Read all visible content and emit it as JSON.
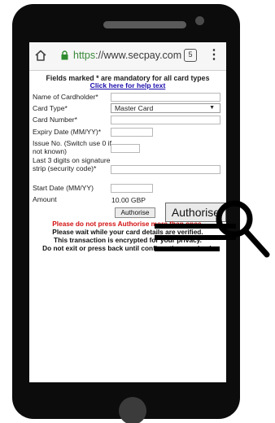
{
  "browser": {
    "url_protocol": "https",
    "url_rest": "://www.secpay.com",
    "tab_count": "5"
  },
  "form": {
    "intro": "Fields marked * are mandatory for all card types",
    "help_link": "Click here for help text",
    "labels": {
      "name": "Name of Cardholder*",
      "card_type": "Card Type*",
      "card_number": "Card Number*",
      "expiry": "Expiry Date (MM/YY)*",
      "issue": "Issue No. (Switch use 0 if not known)",
      "security": "Last 3 digits on signature strip (security code)*",
      "start": "Start Date (MM/YY)",
      "amount": "Amount"
    },
    "card_type_value": "Master Card",
    "amount_value": "10.00 GBP",
    "authorise_small": "Authorise",
    "authorise_big": "Authorise"
  },
  "messages": {
    "warning_red": "Please do not press Authorise more than once.",
    "wait": "Please wait while your card details are verified.",
    "encrypted": "This transaction is encrypted for your privacy.",
    "dont_exit": "Do not exit or press back until confirmation received."
  }
}
